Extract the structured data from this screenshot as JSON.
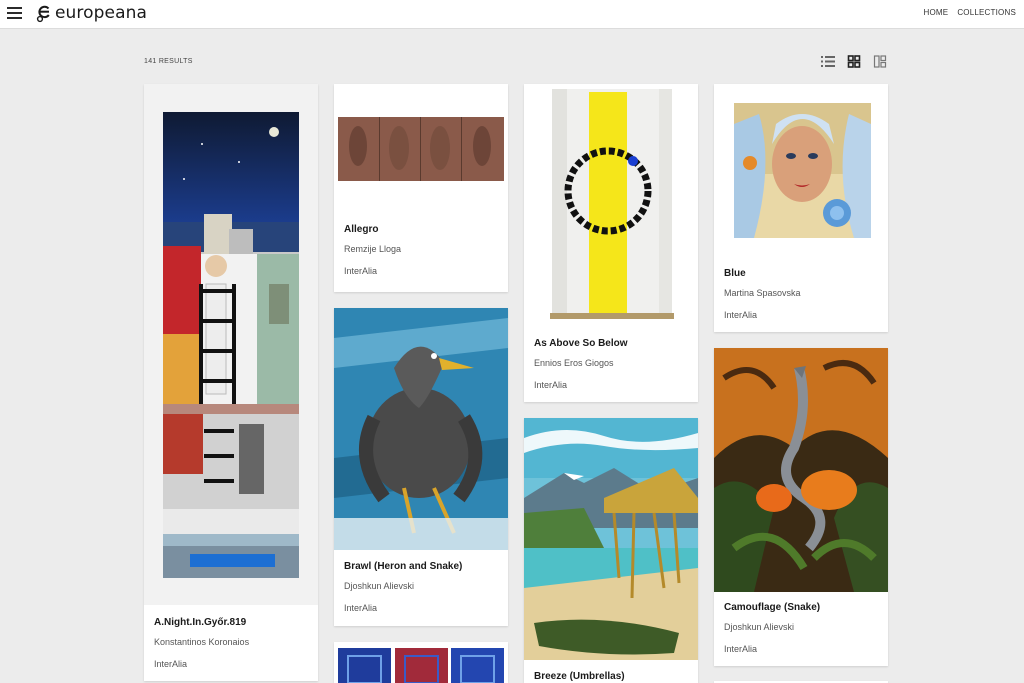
{
  "header": {
    "logo_text": "europeana",
    "nav": [
      "HOME",
      "COLLECTIONS"
    ]
  },
  "results": {
    "count_label": "141 RESULTS",
    "views": [
      "list-view-icon",
      "grid-view-icon",
      "mosaic-view-icon"
    ]
  },
  "cards": [
    {
      "title": "A.Night.In.Győr.819",
      "creator": "Konstantinos Koronaios",
      "provider": "InterAlia"
    },
    {
      "title": "Allegro",
      "creator": "Remzije Lloga",
      "provider": "InterAlia"
    },
    {
      "title": "Brawl (Heron and Snake)",
      "creator": "Djoshkun Alievski",
      "provider": "InterAlia"
    },
    {
      "title": "As Above So Below",
      "creator": "Ennios Eros Giogos",
      "provider": "InterAlia"
    },
    {
      "title": "Breeze (Umbrellas)",
      "creator": "",
      "provider": ""
    },
    {
      "title": "Blue",
      "creator": "Martina Spasovska",
      "provider": "InterAlia"
    },
    {
      "title": "Camouflage (Snake)",
      "creator": "Djoshkun Alievski",
      "provider": "InterAlia"
    }
  ]
}
